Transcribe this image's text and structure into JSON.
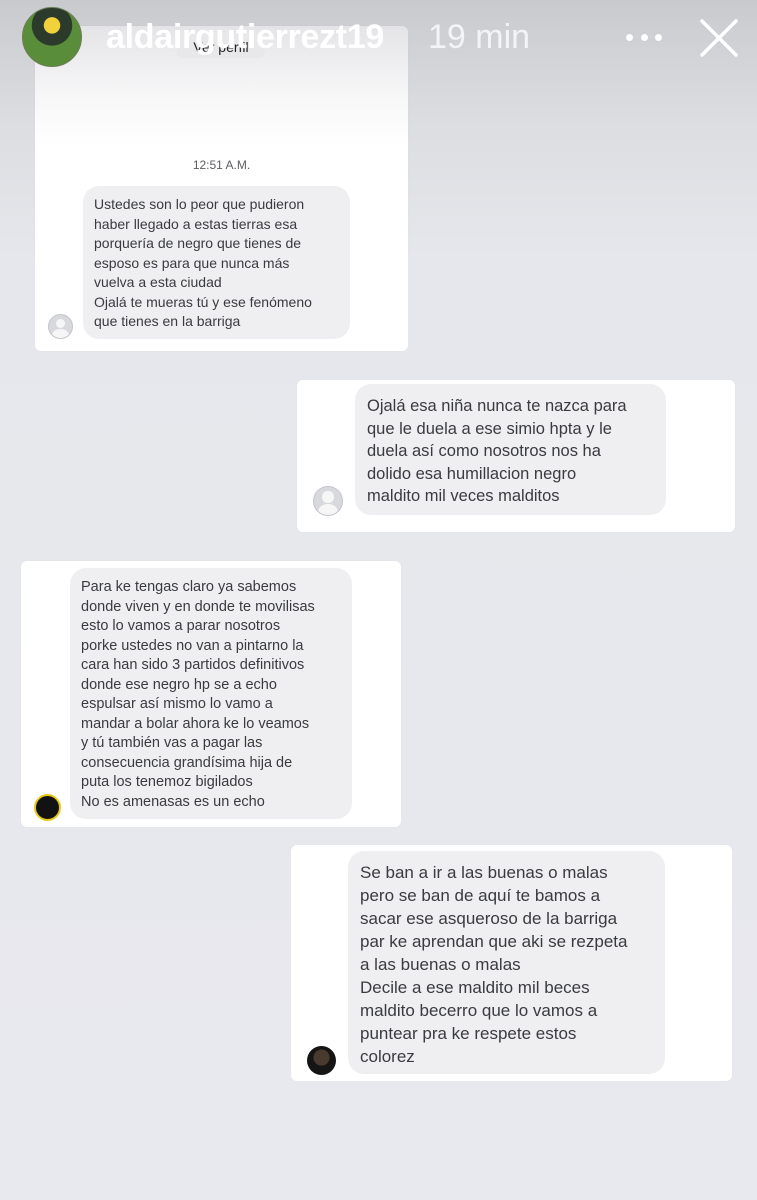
{
  "story_header": {
    "username": "aldairgutierrezt19",
    "time": "19 min"
  },
  "screenshots": [
    {
      "header_fragment": "Ver perfil",
      "timestamp": "12:51 A.M.",
      "message": "Ustedes son lo peor que pudieron\nhaber llegado a estas tierras esa\nporquería de negro que tienes de\nesposo es para que nunca más\nvuelva a esta ciudad\nOjalá te mueras tú y ese fenómeno\nque tienes en la barriga"
    },
    {
      "message": "Ojalá esa niña nunca te nazca para\nque le duela a ese simio hpta y le\nduela así como nosotros nos ha\ndolido esa humillacion negro\nmaldito mil veces malditos"
    },
    {
      "message": "Para ke tengas claro ya sabemos\ndonde viven y en donde te movilisas\nesto lo vamos a parar nosotros\nporke ustedes no van a pintarno la\ncara han sido 3 partidos definitivos\ndonde ese negro hp se a echo\nespulsar así mismo lo vamo a\nmandar a bolar ahora ke lo veamos\ny tú también vas a pagar las\nconsecuencia grandísima hija de\nputa los tenemoz bigilados\nNo es amenasas es un echo"
    },
    {
      "message": "Se ban a ir a las buenas o malas\npero se ban de aquí te bamos a\nsacar ese asqueroso de la barriga\npar ke aprendan que aki se rezpeta\na las buenas o malas\nDecile a ese maldito mil beces\nmaldito becerro que lo vamos a\npuntear pra ke respete estos\ncolorez"
    }
  ]
}
